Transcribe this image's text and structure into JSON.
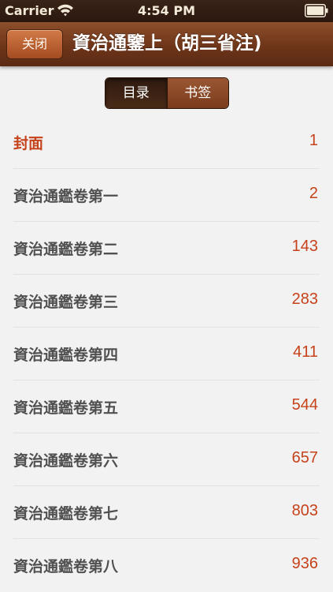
{
  "status_bar": {
    "carrier": "Carrier",
    "time": "4:54 PM",
    "wifi_icon": "wifi-icon",
    "battery_icon": "battery-icon"
  },
  "nav_bar": {
    "close_label": "关闭",
    "title": "資治通鑒上（胡三省注)"
  },
  "segmented_control": {
    "selected_index": 0,
    "segments": [
      "目录",
      "书签"
    ]
  },
  "toc": {
    "items": [
      {
        "title": "封面",
        "page": "1",
        "active": true
      },
      {
        "title": "資治通鑑卷第一",
        "page": "2",
        "active": false
      },
      {
        "title": "資治通鑑卷第二",
        "page": "143",
        "active": false
      },
      {
        "title": "資治通鑑卷第三",
        "page": "283",
        "active": false
      },
      {
        "title": "資治通鑑卷第四",
        "page": "411",
        "active": false
      },
      {
        "title": "資治通鑑卷第五",
        "page": "544",
        "active": false
      },
      {
        "title": "資治通鑑卷第六",
        "page": "657",
        "active": false
      },
      {
        "title": "資治通鑑卷第七",
        "page": "803",
        "active": false
      },
      {
        "title": "資治通鑑卷第八",
        "page": "936",
        "active": false
      }
    ]
  },
  "colors": {
    "accent": "#c6421a",
    "nav_brown": "#6e3519",
    "button_orange": "#b85a2c"
  }
}
